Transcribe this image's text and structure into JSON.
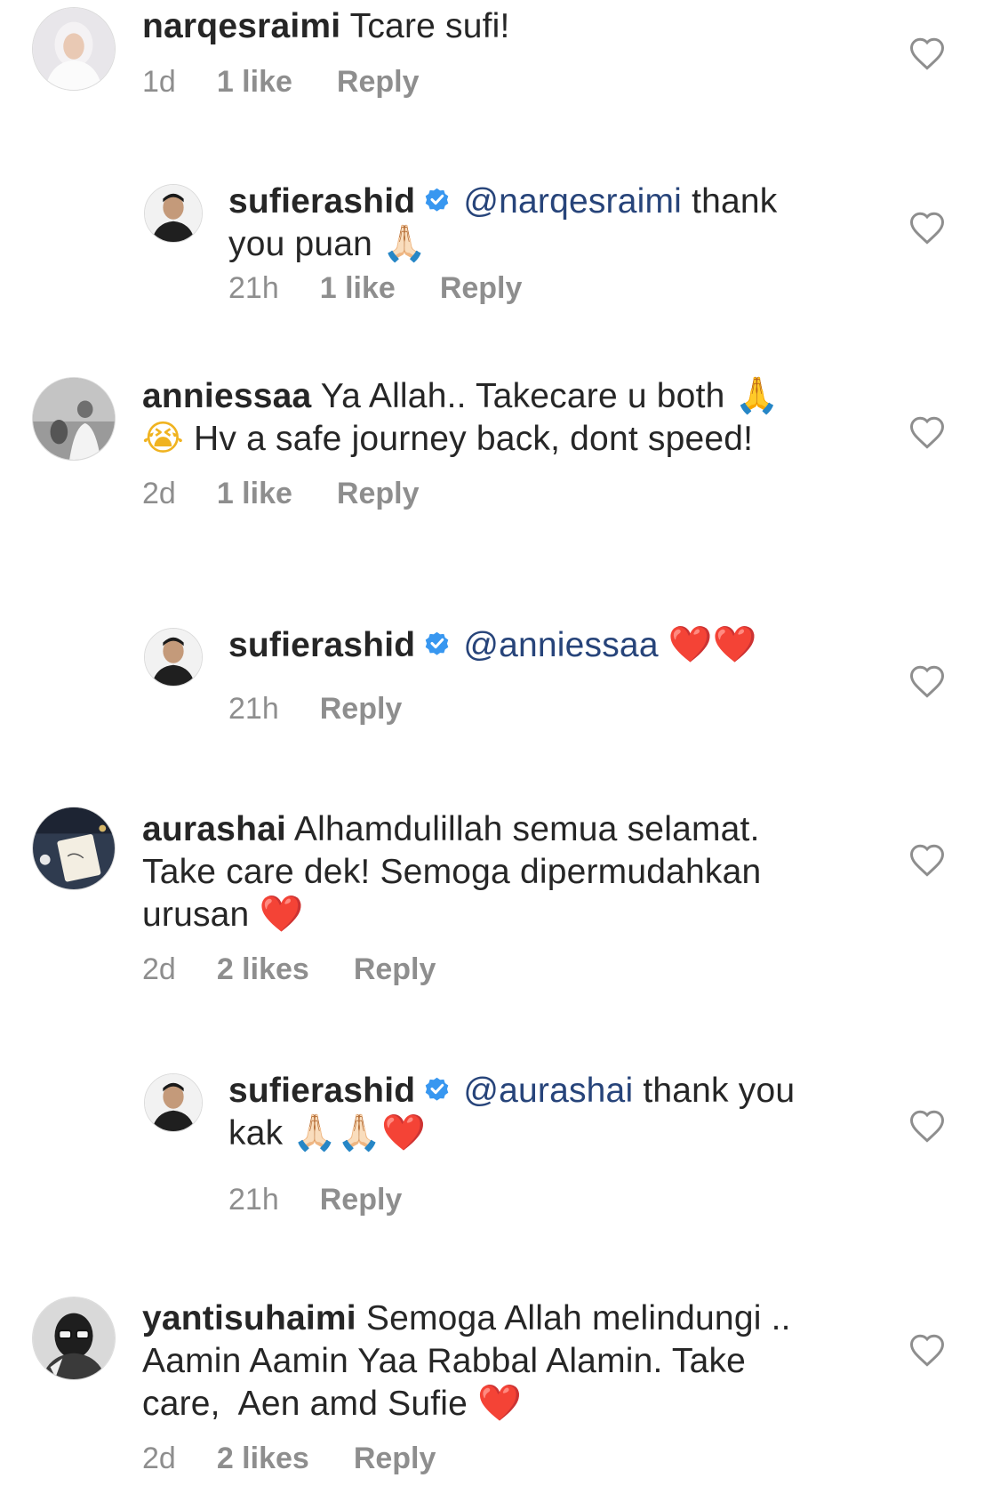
{
  "comments": [
    {
      "username": "narqesraimi",
      "text": "Tcare sufi!",
      "time": "1d",
      "likes": "1 like",
      "reply_label": "Reply"
    },
    {
      "username": "sufierashid",
      "mention": "@narqesraimi",
      "text_a": " thank",
      "text_b": "you puan ",
      "emoji_1": "🙏🏻",
      "time": "21h",
      "likes": "1 like",
      "reply_label": "Reply"
    },
    {
      "username": "anniessaa",
      "text_a": "Ya Allah.. Takecare u both ",
      "emoji_1": "🙏",
      "emoji_2": "😭",
      "text_b": " Hv a safe journey back, dont speed!",
      "time": "2d",
      "likes": "1 like",
      "reply_label": "Reply"
    },
    {
      "username": "sufierashid",
      "mention": "@anniessaa",
      "emoji_1": "❤️",
      "emoji_2": "❤️",
      "time": "21h",
      "reply_label": "Reply"
    },
    {
      "username": "aurashai",
      "text_a": "Alhamdulillah semua selamat.",
      "text_b": "Take care dek! Semoga dipermudahkan",
      "text_c": "urusan ",
      "emoji_1": "❤️",
      "time": "2d",
      "likes": "2 likes",
      "reply_label": "Reply"
    },
    {
      "username": "sufierashid",
      "mention": "@aurashai",
      "text_a": " thank you",
      "text_b": "kak ",
      "emoji_1": "🙏🏻",
      "emoji_2": "🙏🏻",
      "emoji_3": "❤️",
      "time": "21h",
      "reply_label": "Reply"
    },
    {
      "username": "yantisuhaimi",
      "text_a": "Semoga Allah melindungi ..",
      "text_b": "Aamin Aamin Yaa Rabbal Alamin. Take",
      "text_c": "care,  Aen amd Sufie ",
      "emoji_1": "❤️",
      "time": "2d",
      "likes": "2 likes",
      "reply_label": "Reply"
    }
  ],
  "colors": {
    "text": "#262626",
    "meta": "#8e8e8e",
    "mention": "#27447a",
    "verified": "#3897f0",
    "heart_outline": "#8e8e8e",
    "emoji_heart": "#e0202a"
  },
  "icons": {
    "like": "heart-outline-icon",
    "verified": "verified-badge-icon"
  }
}
